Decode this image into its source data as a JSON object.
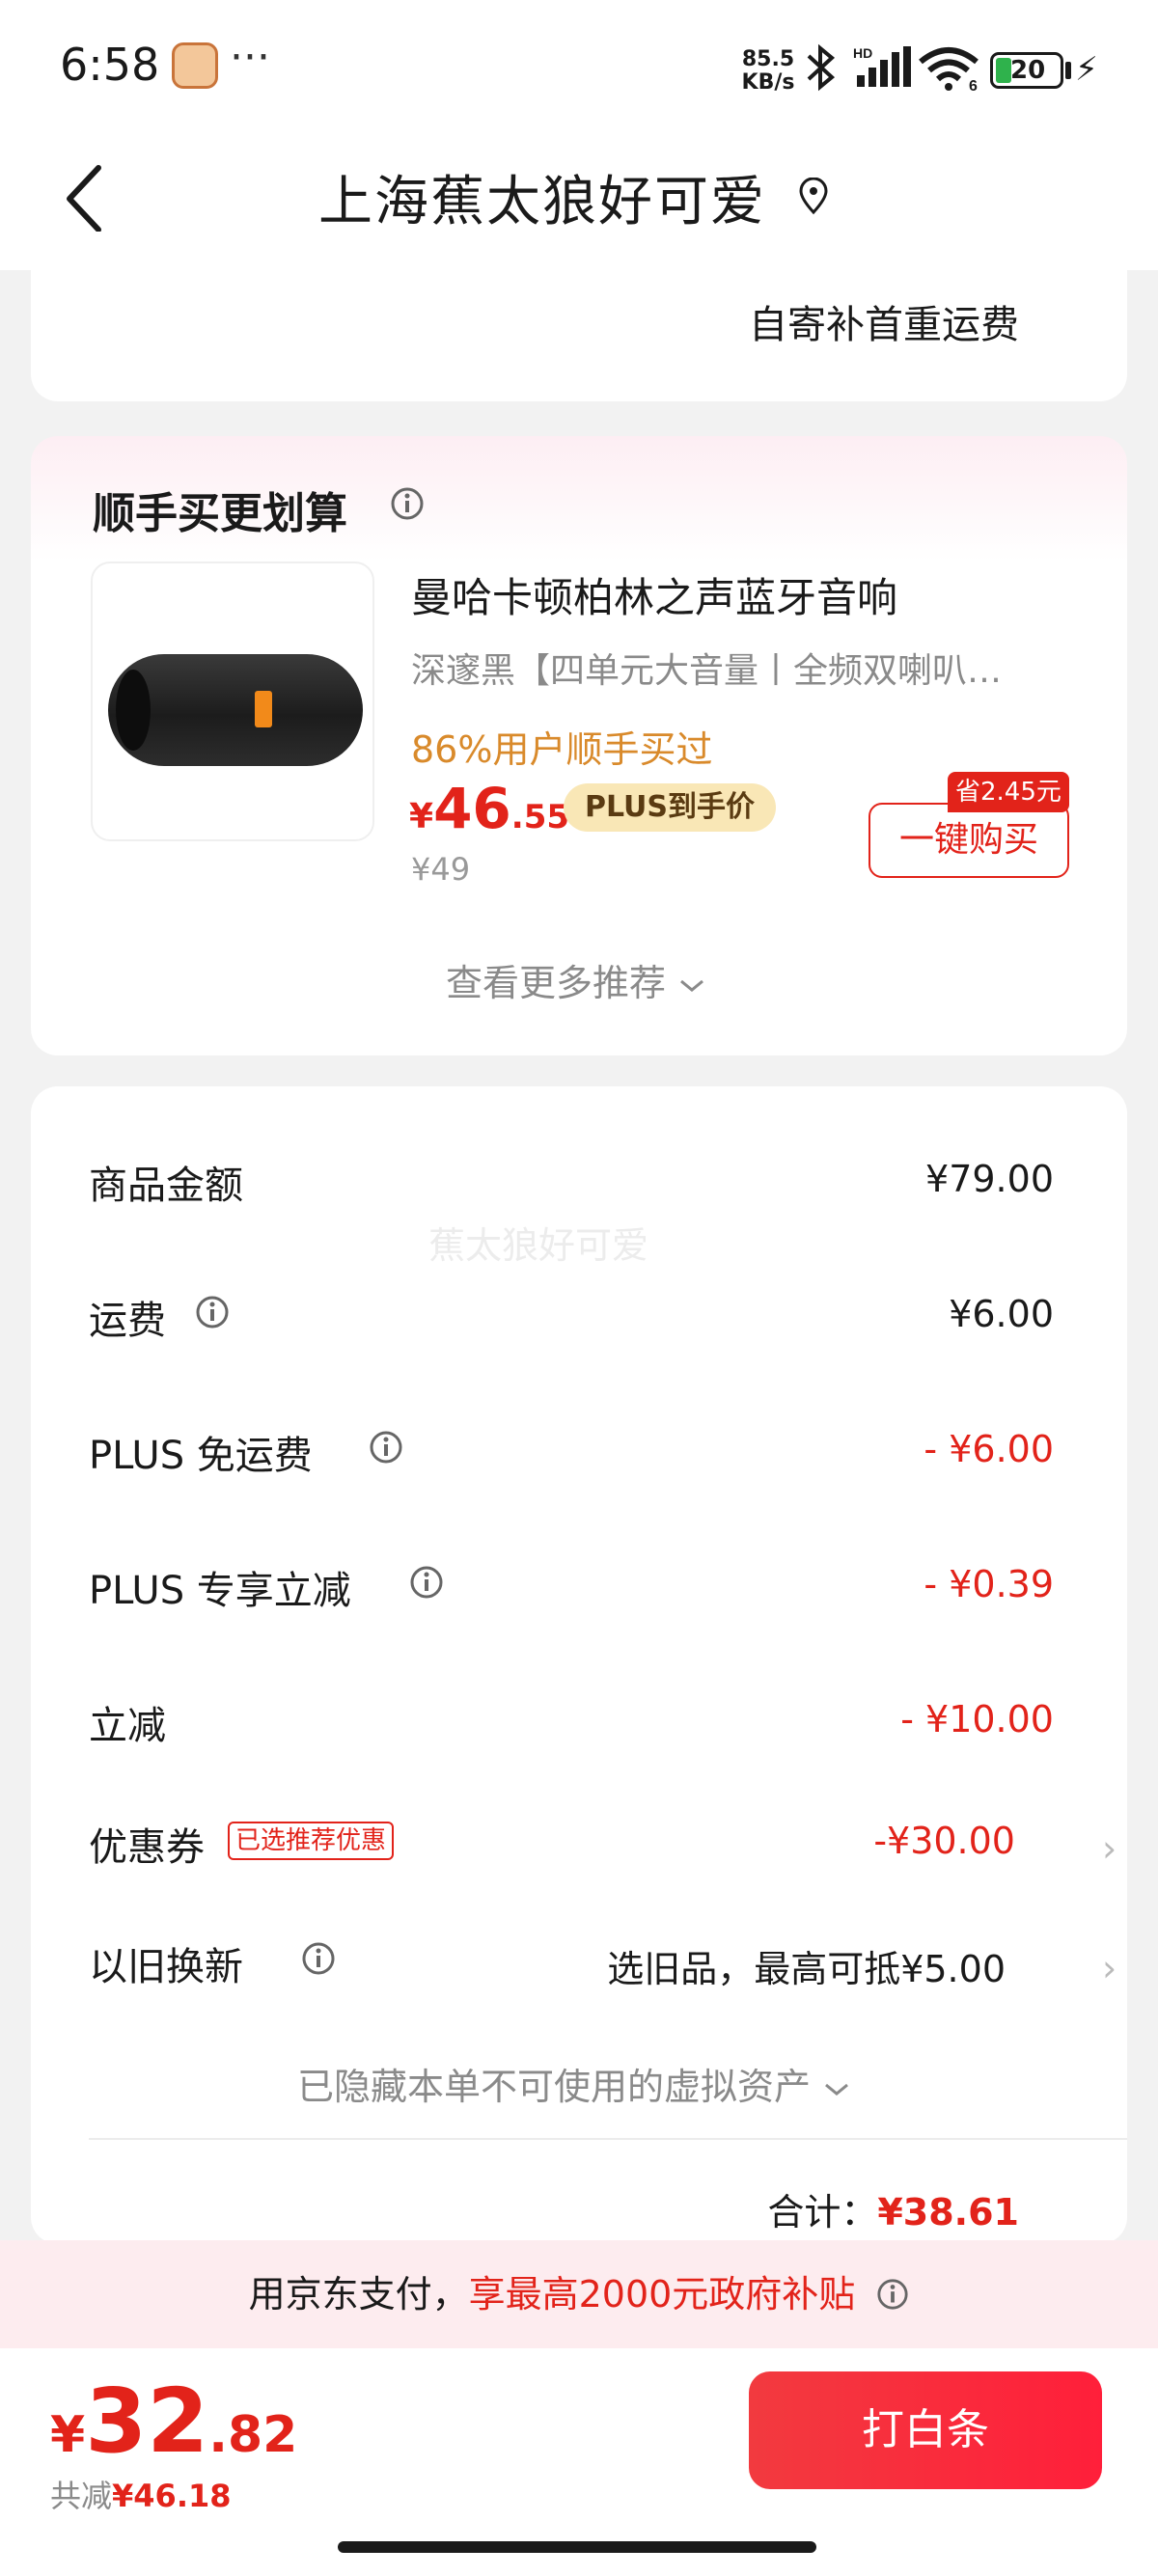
{
  "status_bar": {
    "time": "6:58",
    "overflow": "···",
    "net_speed_value": "85.5",
    "net_speed_unit": "KB/s",
    "signal_label": "HD",
    "wifi_label": "6",
    "battery": "20"
  },
  "header": {
    "title": "上海蕉太狼好可爱"
  },
  "shipping": {
    "note": "自寄补首重运费"
  },
  "recommend": {
    "title": "顺手买更划算",
    "product": {
      "name": "曼哈卡顿柏林之声蓝牙音响",
      "desc": "深邃黑【四单元大音量丨全频双喇叭…",
      "social_proof": "86%用户顺手买过",
      "price_currency": "¥",
      "price_int": "46",
      "price_dec": ".55",
      "plus_badge": "PLUS到手价",
      "original_price": "¥49",
      "save_tag": "省2.45元",
      "buy_label": "一键购买"
    },
    "more_label": "查看更多推荐"
  },
  "bill": {
    "watermark": "蕉太狼好可爱",
    "rows": [
      {
        "label": "商品金额",
        "value": "¥79.00"
      },
      {
        "label": "运费",
        "value": "¥6.00"
      },
      {
        "label": "PLUS 免运费",
        "value": "- ¥6.00"
      },
      {
        "label": "PLUS 专享立减",
        "value": "- ¥0.39"
      },
      {
        "label": "立减",
        "value": "- ¥10.00"
      },
      {
        "label": "优惠券",
        "value": "-¥30.00",
        "tag": "已选推荐优惠"
      },
      {
        "label": "以旧换新",
        "value": "选旧品，最高可抵¥5.00"
      }
    ],
    "hidden_assets": "已隐藏本单不可使用的虚拟资产",
    "total_label": "合计：",
    "total_value": "¥38.61"
  },
  "subsidy": {
    "prefix": "用京东支付，",
    "highlight": "享最高2000元政府补贴"
  },
  "footer": {
    "currency": "¥",
    "price_int": "32",
    "price_dec": ".82",
    "saved_label": "共减",
    "saved_value": "¥46.18",
    "pay_label": "打白条"
  },
  "colors": {
    "accent": "#e2231a",
    "plus_gold": "#f9e7b6",
    "social_orange": "#d98a2b"
  }
}
